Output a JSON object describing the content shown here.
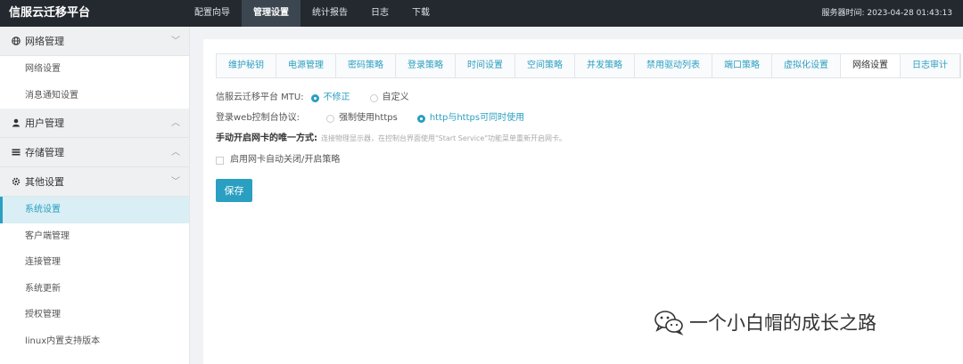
{
  "header": {
    "title": "信服云迁移平台",
    "nav": [
      {
        "label": "配置向导"
      },
      {
        "label": "管理设置"
      },
      {
        "label": "统计报告"
      },
      {
        "label": "日志"
      },
      {
        "label": "下载"
      }
    ],
    "server_time_label": "服务器时间:",
    "server_time": "2023-04-28 01:43:13"
  },
  "sidebar": {
    "groups": [
      {
        "label": "网络管理",
        "icon": "globe-icon",
        "chevron": "down",
        "items": [
          {
            "label": "网络设置"
          },
          {
            "label": "消息通知设置"
          }
        ]
      },
      {
        "label": "用户管理",
        "icon": "user-icon",
        "chevron": "up",
        "items": []
      },
      {
        "label": "存储管理",
        "icon": "storage-icon",
        "chevron": "up",
        "items": []
      },
      {
        "label": "其他设置",
        "icon": "gear-icon",
        "chevron": "down",
        "items": [
          {
            "label": "系统设置"
          },
          {
            "label": "客户端管理"
          },
          {
            "label": "连接管理"
          },
          {
            "label": "系统更新"
          },
          {
            "label": "授权管理"
          },
          {
            "label": "linux内置支持版本"
          }
        ]
      }
    ],
    "active_item": "系统设置"
  },
  "main": {
    "tabs": [
      {
        "label": "维护秘钥"
      },
      {
        "label": "电源管理"
      },
      {
        "label": "密码策略"
      },
      {
        "label": "登录策略"
      },
      {
        "label": "时间设置"
      },
      {
        "label": "空间策略"
      },
      {
        "label": "并发策略"
      },
      {
        "label": "禁用驱动列表"
      },
      {
        "label": "端口策略"
      },
      {
        "label": "虚拟化设置"
      },
      {
        "label": "网络设置"
      },
      {
        "label": "日志审计"
      }
    ],
    "active_tab": "网络设置",
    "mtu": {
      "label": "信服云迁移平台 MTU:",
      "options": [
        {
          "label": "不修正",
          "checked": true
        },
        {
          "label": "自定义",
          "checked": false
        }
      ]
    },
    "protocol": {
      "label": "登录web控制台协议:",
      "options": [
        {
          "label": "强制使用https",
          "checked": false
        },
        {
          "label": "http与https可同时使用",
          "checked": true
        }
      ]
    },
    "nic_hint": {
      "label": "手动开启网卡的唯一方式:",
      "text": "连接物理显示器，在控制台界面使用\"Start Service\"功能菜单重新开启网卡。"
    },
    "auto_nic": {
      "label": "启用网卡自动关闭/开启策略",
      "checked": false
    },
    "save_label": "保存"
  },
  "watermark": {
    "text": "一个小白帽的成长之路"
  },
  "colors": {
    "accent": "#2a9fc1",
    "topbar": "#23292f",
    "nav_active": "#3c4650",
    "sidebar_group": "#eef0f2",
    "sidebar_active": "#d9eef5"
  }
}
